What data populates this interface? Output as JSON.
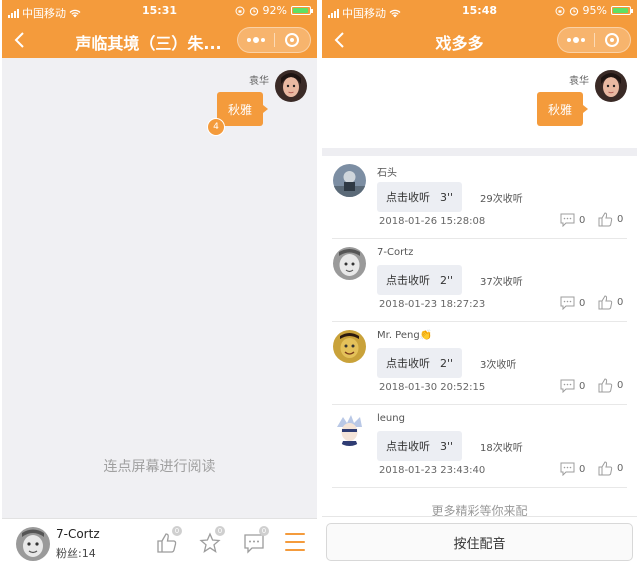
{
  "left": {
    "status": {
      "carrier": "中国移动",
      "time": "15:31",
      "battery": "92%",
      "battery_fraction": 0.92
    },
    "nav": {
      "title": "声临其境（三）朱..."
    },
    "dialogue": {
      "speaker": "袁华",
      "line": "秋雅",
      "recording_count": "4"
    },
    "read_hint": "连点屏幕进行阅读",
    "user": {
      "name": "7-Cortz",
      "fans": "粉丝:14"
    },
    "badges": {
      "like": "0",
      "star": "0",
      "comment": "0"
    }
  },
  "right": {
    "status": {
      "carrier": "中国移动",
      "time": "15:48",
      "battery": "95%",
      "battery_fraction": 0.95
    },
    "nav": {
      "title": "戏多多"
    },
    "dialogue": {
      "speaker": "袁华",
      "line": "秋雅"
    },
    "play_label": "点击收听",
    "comments": [
      {
        "name": "石头",
        "duration": "3''",
        "plays": "29次收听",
        "date": "2018-01-26 15:28:08",
        "replies": "0",
        "likes": "0"
      },
      {
        "name": "7-Cortz",
        "duration": "2''",
        "plays": "37次收听",
        "date": "2018-01-23 18:27:23",
        "replies": "0",
        "likes": "0"
      },
      {
        "name": "Mr. Peng👏",
        "duration": "2''",
        "plays": "3次收听",
        "date": "2018-01-30 20:52:15",
        "replies": "0",
        "likes": "0"
      },
      {
        "name": "leung",
        "duration": "3''",
        "plays": "18次收听",
        "date": "2018-01-23 23:43:40",
        "replies": "0",
        "likes": "0"
      }
    ],
    "more_text": "更多精彩等你来配",
    "record_button": "按住配音"
  },
  "colors": {
    "accent": "#f49b3c",
    "battery": "#5ee065"
  },
  "icons": [
    "back-icon",
    "more-dots-icon",
    "close-target-icon",
    "thumbs-up-icon",
    "star-icon",
    "comment-icon",
    "menu-icon",
    "wifi-icon",
    "alarm-icon",
    "lock-rotation-icon"
  ]
}
